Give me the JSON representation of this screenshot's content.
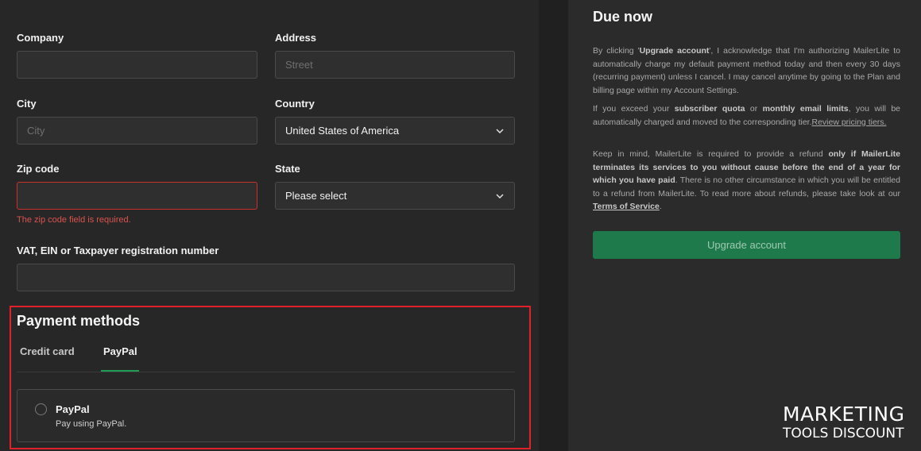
{
  "form": {
    "company": {
      "label": "Company",
      "value": "",
      "placeholder": ""
    },
    "address": {
      "label": "Address",
      "value": "",
      "placeholder": "Street"
    },
    "city": {
      "label": "City",
      "value": "",
      "placeholder": "City"
    },
    "country": {
      "label": "Country",
      "value": "United States of America"
    },
    "zip": {
      "label": "Zip code",
      "value": "",
      "error": "The zip code field is required."
    },
    "state": {
      "label": "State",
      "value": "Please select"
    },
    "vat": {
      "label": "VAT, EIN or Taxpayer registration number",
      "value": ""
    }
  },
  "payment": {
    "title": "Payment methods",
    "tabs": [
      {
        "label": "Credit card",
        "active": false
      },
      {
        "label": "PayPal",
        "active": true
      }
    ],
    "option": {
      "title": "PayPal",
      "description": "Pay using PayPal."
    }
  },
  "summary": {
    "title": "Due now",
    "p1_a": "By clicking '",
    "p1_b": "Upgrade account",
    "p1_c": "', I acknowledge that I'm authorizing MailerLite to automatically charge my default payment method today and then every 30 days (recurring payment) unless I cancel. I may cancel anytime by going to the Plan and billing page within my Account Settings.",
    "p2_a": "If you exceed your ",
    "p2_b": "subscriber quota",
    "p2_c": " or ",
    "p2_d": "monthly email limits",
    "p2_e": ", you will be automatically charged and moved to the corresponding tier.",
    "p2_link": "Review pricing tiers.",
    "p3_a": "Keep in mind, MailerLite is required to provide a refund ",
    "p3_b": "only if MailerLite terminates its services to you without cause before the end of a year for which you have paid",
    "p3_c": ". There is no other circumstance in which you will be entitled to a refund from MailerLite. To read more about refunds, please take look at our ",
    "p3_link": "Terms of Service",
    "p3_d": ".",
    "button": "Upgrade account"
  },
  "watermark": {
    "line1": "MARKETING",
    "line2": "TOOLS DISCOUNT"
  },
  "colors": {
    "accent": "#1f9d55",
    "button": "#1e7a4a",
    "error": "#d9534f",
    "highlight": "#e0202a"
  },
  "icons": {
    "select": "chevron-down-icon",
    "radio": "radio-icon"
  }
}
